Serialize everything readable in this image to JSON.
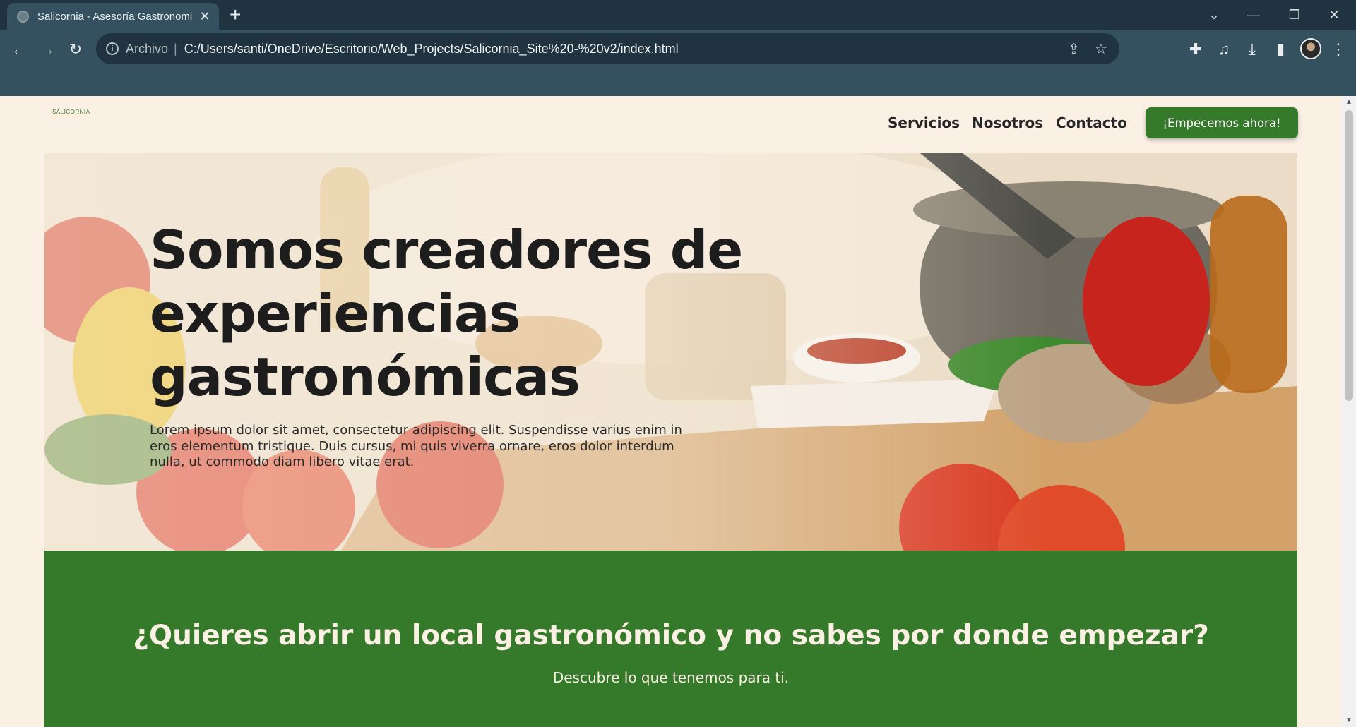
{
  "browser": {
    "tab_title": "Salicornia - Asesoría Gastronomi",
    "tab_close": "✕",
    "new_tab": "+",
    "window_controls": {
      "dropdown": "⌄",
      "minimize": "—",
      "restore": "❐",
      "close": "✕"
    },
    "nav": {
      "back": "←",
      "forward": "→",
      "reload": "↻"
    },
    "address": {
      "scheme_label": "Archivo",
      "separator": "|",
      "url": "C:/Users/santi/OneDrive/Escritorio/Web_Projects/Salicornia_Site%20-%20v2/index.html"
    },
    "icons": [
      "share-icon",
      "star-icon",
      "extensions-icon",
      "media-icon",
      "download-icon",
      "sidepanel-icon",
      "avatar",
      "menu-icon"
    ]
  },
  "site": {
    "logo_text": "SALICORNIA",
    "nav": [
      {
        "label": "Servicios"
      },
      {
        "label": "Nosotros"
      },
      {
        "label": "Contacto"
      }
    ],
    "cta_label": "¡Empecemos ahora!",
    "hero": {
      "title": "Somos creadores de experiencias gastronómicas",
      "text": "Lorem ipsum dolor sit amet, consectetur adipiscing elit. Suspendisse varius enim in eros elementum tristique. Duis cursus, mi quis viverra ornare, eros dolor interdum nulla, ut commodo diam libero vitae erat."
    },
    "band": {
      "title": "¿Quieres abrir un local gastronómico y no sabes por donde empezar?",
      "subtitle": "Descubre lo que tenemos para ti."
    }
  },
  "colors": {
    "brand_green": "#357a2a",
    "page_bg": "#fbf0e4",
    "chrome_dark": "#1f3340",
    "chrome_toolbar": "#35505e"
  }
}
